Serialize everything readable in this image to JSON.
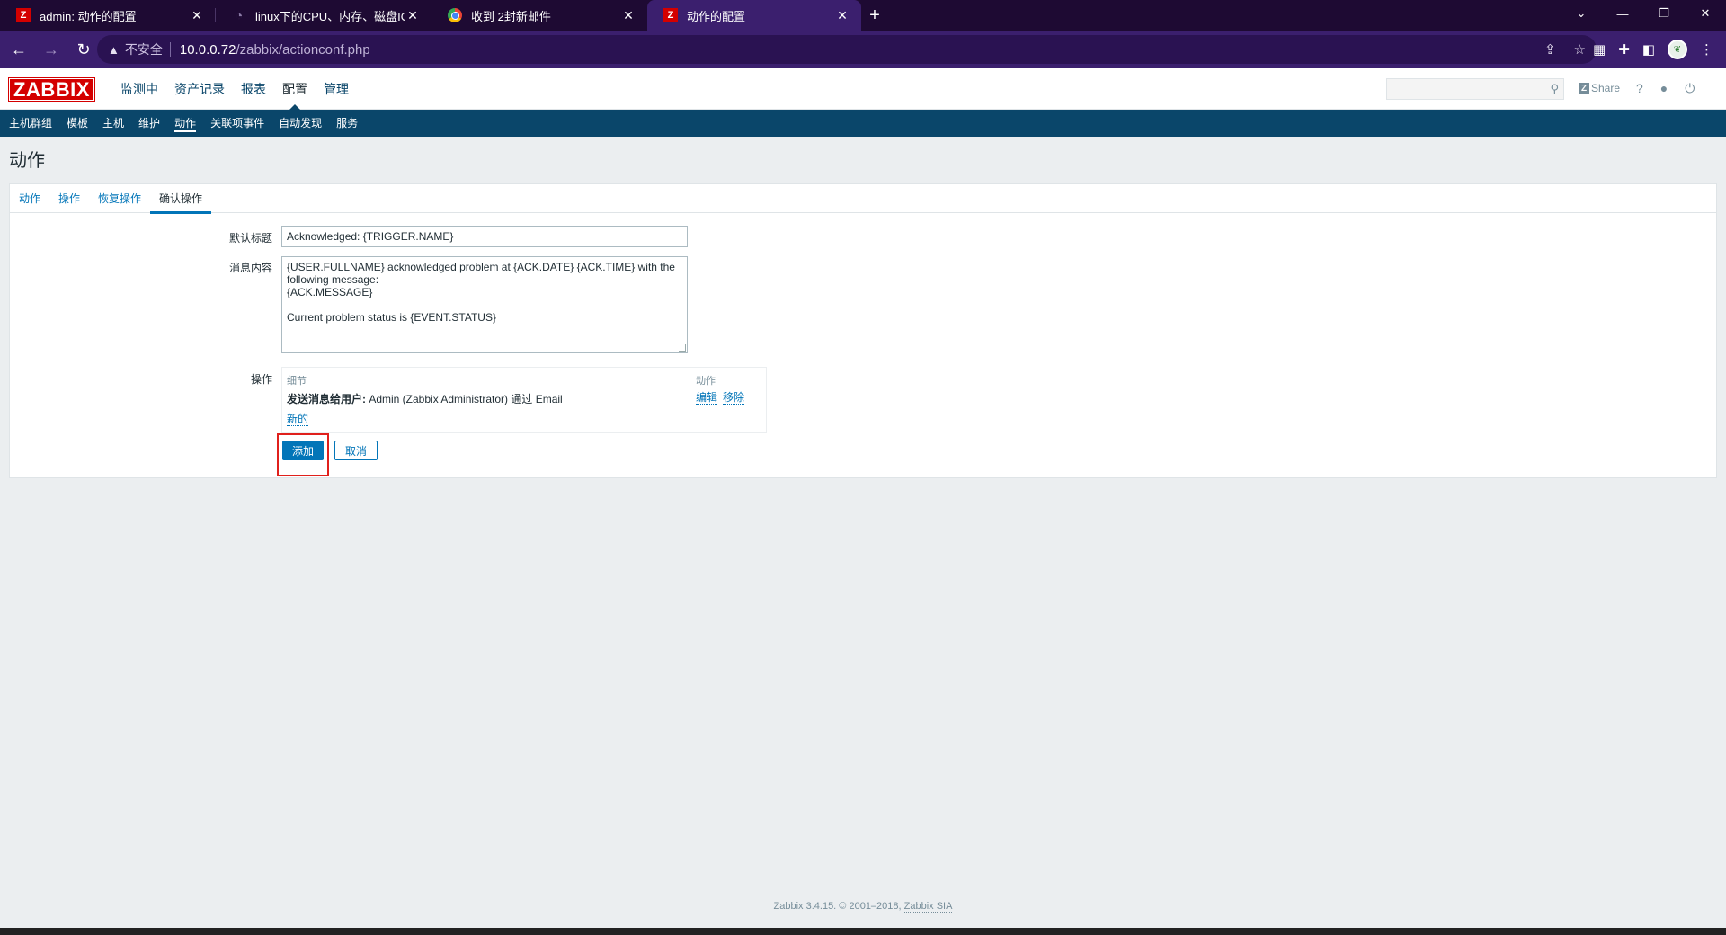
{
  "browser": {
    "tabs": [
      {
        "title": "admin: 动作的配置",
        "icon": "zabbix-favicon",
        "active": false
      },
      {
        "title": "linux下的CPU、内存、磁盘IO、",
        "icon": "github-favicon",
        "active": false
      },
      {
        "title": "收到 2封新邮件",
        "icon": "mail-favicon",
        "active": false
      },
      {
        "title": "动作的配置",
        "icon": "zabbix-favicon",
        "active": true
      }
    ],
    "new_tab": "+",
    "security_label": "不安全",
    "url_host": "10.0.0.72",
    "url_path": "/zabbix/actionconf.php"
  },
  "zabbix": {
    "logo": "ZABBIX",
    "top_menu": [
      "监测中",
      "资产记录",
      "报表",
      "配置",
      "管理"
    ],
    "top_menu_selected": "配置",
    "share_label": "Share",
    "sub_menu": [
      "主机群组",
      "模板",
      "主机",
      "维护",
      "动作",
      "关联项事件",
      "自动发现",
      "服务"
    ],
    "sub_menu_selected": "动作"
  },
  "page": {
    "title": "动作",
    "tabs": [
      "动作",
      "操作",
      "恢复操作",
      "确认操作"
    ],
    "active_tab": "确认操作",
    "form": {
      "subject_label": "默认标题",
      "subject_value": "Acknowledged: {TRIGGER.NAME}",
      "message_label": "消息内容",
      "message_value": "{USER.FULLNAME} acknowledged problem at {ACK.DATE} {ACK.TIME} with the following message:\n{ACK.MESSAGE}\n\nCurrent problem status is {EVENT.STATUS}",
      "operations_label": "操作",
      "operations_table": {
        "col_details": "细节",
        "col_action": "动作",
        "row_detail_bold": "发送消息给用户:",
        "row_detail_text": " Admin (Zabbix Administrator) 通过 Email",
        "edit_link": "编辑",
        "remove_link": "移除",
        "new_link": "新的"
      },
      "add_button": "添加",
      "cancel_button": "取消"
    }
  },
  "footer": {
    "text": "Zabbix 3.4.15. © 2001–2018, ",
    "link": "Zabbix SIA"
  },
  "colors": {
    "browser_frame": "#1e0a33",
    "browser_toolbar": "#3b1f6e",
    "zabbix_red": "#d40000",
    "zabbix_nav": "#0a466a",
    "link_blue": "#0275b8",
    "highlight_red": "#e0201c"
  }
}
